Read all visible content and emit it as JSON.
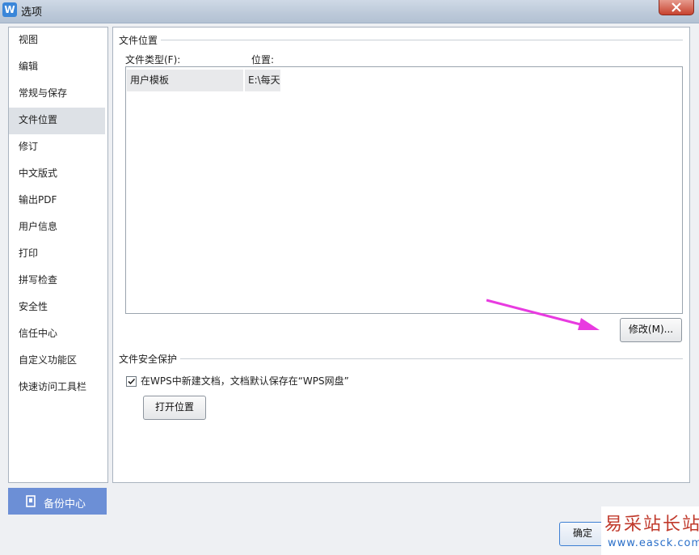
{
  "window": {
    "title": "选项",
    "app_icon_letter": "W"
  },
  "sidebar": {
    "items": [
      {
        "label": "视图"
      },
      {
        "label": "编辑"
      },
      {
        "label": "常规与保存"
      },
      {
        "label": "文件位置"
      },
      {
        "label": "修订"
      },
      {
        "label": "中文版式"
      },
      {
        "label": "输出PDF"
      },
      {
        "label": "用户信息"
      },
      {
        "label": "打印"
      },
      {
        "label": "拼写检查"
      },
      {
        "label": "安全性"
      },
      {
        "label": "信任中心"
      },
      {
        "label": "自定义功能区"
      },
      {
        "label": "快速访问工具栏"
      }
    ],
    "active_index": 3,
    "backup_label": "备份中心"
  },
  "file_location": {
    "group_title": "文件位置",
    "col_type_label": "文件类型(F):",
    "col_location_label": "位置:",
    "rows": [
      {
        "type": "用户模板",
        "location": "E:\\每天"
      }
    ],
    "modify_button_label": "修改(M)..."
  },
  "file_security": {
    "group_title": "文件安全保护",
    "checkbox_checked": true,
    "checkbox_label": "在WPS中新建文档，文档默认保存在“WPS网盘”",
    "open_location_button_label": "打开位置"
  },
  "footer": {
    "ok_button_label": "确定"
  },
  "watermark": {
    "text": "易采站长站",
    "url": "www.easck.com"
  },
  "colors": {
    "accent_backup": "#6c8fd6",
    "arrow": "#e83be0",
    "close": "#c7432f"
  }
}
